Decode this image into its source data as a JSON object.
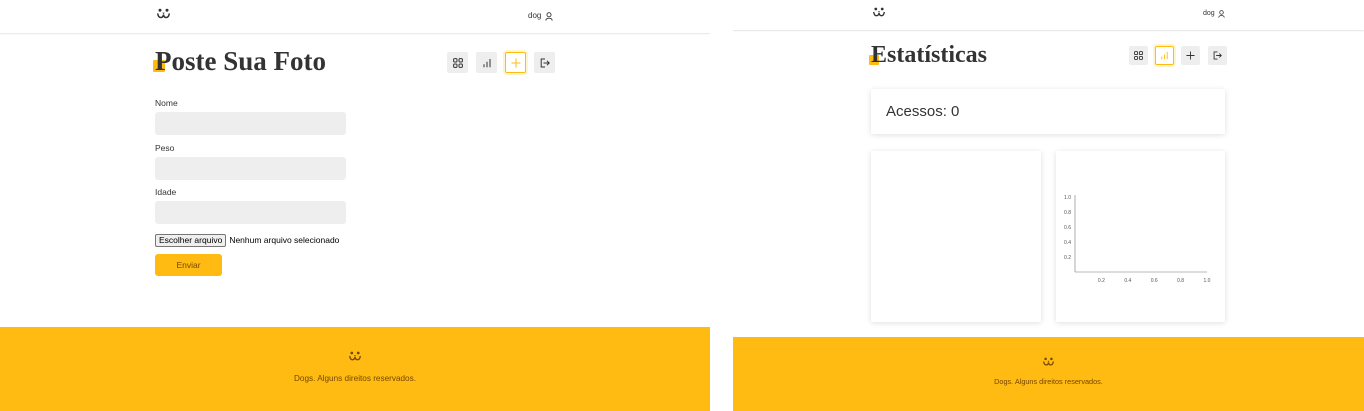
{
  "colors": {
    "accent": "#ffbb11",
    "footer_text": "#764701",
    "input_bg": "#eeeeee",
    "text": "#333333"
  },
  "left": {
    "header": {
      "logo_icon": "dog-logo-icon",
      "user_label": "dog",
      "user_icon": "user-icon"
    },
    "title": "Poste Sua Foto",
    "nav_icons": [
      "grid-icon",
      "bar-chart-icon",
      "plus-icon",
      "logout-icon"
    ],
    "active_nav": 2,
    "form": {
      "fields": [
        {
          "label": "Nome",
          "value": ""
        },
        {
          "label": "Peso",
          "value": ""
        },
        {
          "label": "Idade",
          "value": ""
        }
      ],
      "file_button": "Escolher arquivo",
      "file_status": "Nenhum arquivo selecionado",
      "submit": "Enviar"
    },
    "footer": {
      "logo_icon": "dog-logo-icon",
      "text": "Dogs. Alguns direitos reservados."
    }
  },
  "right": {
    "header": {
      "logo_icon": "dog-logo-icon",
      "user_label": "dog",
      "user_icon": "user-icon"
    },
    "title": "Estatísticas",
    "nav_icons": [
      "grid-icon",
      "bar-chart-icon",
      "plus-icon",
      "logout-icon"
    ],
    "active_nav": 1,
    "stats": {
      "label": "Acessos:",
      "count": 0
    },
    "chart": {
      "xlim": [
        0,
        1
      ],
      "ylim": [
        0,
        1
      ],
      "x_ticks": [
        "0.2",
        "0.4",
        "0.6",
        "0.8",
        "1.0"
      ],
      "y_ticks": [
        "0.2",
        "0.4",
        "0.6",
        "0.8",
        "1.0"
      ]
    },
    "footer": {
      "logo_icon": "dog-logo-icon",
      "text": "Dogs. Alguns direitos reservados."
    }
  }
}
